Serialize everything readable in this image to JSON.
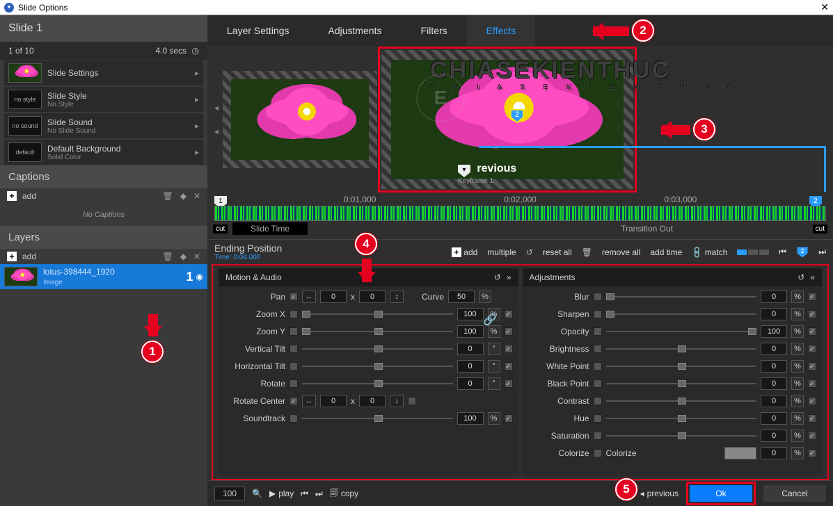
{
  "window": {
    "title": "Slide Options"
  },
  "sidebar": {
    "header": "Slide 1",
    "index": "1 of 10",
    "duration": "4.0 secs",
    "settings": {
      "slide_settings": "Slide Settings",
      "style_label": "Slide Style",
      "style_value": "No Style",
      "style_badge": "no style",
      "sound_label": "Slide Sound",
      "sound_value": "No Slide Sound",
      "sound_badge": "no sound",
      "bg_label": "Default Background",
      "bg_value": "Solid Color",
      "bg_badge": "default"
    },
    "captions_title": "Captions",
    "add_label": "add",
    "no_captions": "No Captions",
    "layers_title": "Layers",
    "layer": {
      "name": "lotus-398444_1920",
      "type": "Image",
      "index": "1"
    }
  },
  "tabs": {
    "t1": "Layer Settings",
    "t2": "Adjustments",
    "t3": "Filters",
    "t4": "Effects"
  },
  "preview": {
    "kf_prev_title": "revious",
    "kf_prev_sub": "Keyframe 1",
    "marker_num": "2"
  },
  "timeline": {
    "ticks": [
      "",
      "0:01,000",
      "0:02,000",
      "0:03,000",
      ""
    ],
    "cut": "cut",
    "slide_time": "Slide Time",
    "transition_out": "Transition Out",
    "left_marker": "1",
    "right_marker": "2"
  },
  "kf_toolbar": {
    "title": "Ending Position",
    "time": "Time: 0:04.000",
    "add": "add",
    "multiple": "multiple",
    "reset_all": "reset all",
    "remove_all": "remove all",
    "add_time": "add time",
    "match": "match",
    "cur_marker": "2"
  },
  "motion": {
    "title": "Motion & Audio",
    "pan": "Pan",
    "pan_x": "0",
    "pan_sep": "x",
    "pan_y": "0",
    "curve": "Curve",
    "curve_val": "50",
    "pct": "%",
    "zoomx": "Zoom X",
    "zoomx_val": "100",
    "zoomy": "Zoom Y",
    "zoomy_val": "100",
    "vtilt": "Vertical Tilt",
    "vtilt_val": "0",
    "deg": "°",
    "htilt": "Horizontal Tilt",
    "htilt_val": "0",
    "rotate": "Rotate",
    "rotate_val": "0",
    "rcenter": "Rotate Center",
    "rcenter_x": "0",
    "rcenter_y": "0",
    "sound": "Soundtrack",
    "sound_val": "100"
  },
  "adjust": {
    "title": "Adjustments",
    "blur": "Blur",
    "blur_val": "0",
    "sharpen": "Sharpen",
    "sharpen_val": "0",
    "opacity": "Opacity",
    "opacity_val": "100",
    "brightness": "Brightness",
    "brightness_val": "0",
    "whitepoint": "White Point",
    "whitepoint_val": "0",
    "blackpoint": "Black Point",
    "blackpoint_val": "0",
    "contrast": "Contrast",
    "contrast_val": "0",
    "hue": "Hue",
    "hue_val": "0",
    "saturation": "Saturation",
    "saturation_val": "0",
    "colorize": "Colorize",
    "colorize_lbl": "Colorize",
    "colorize_val": "0"
  },
  "footer": {
    "zoom": "100",
    "play": "play",
    "copy": "copy",
    "previous": "previous",
    "ok": "Ok",
    "cancel": "Cancel"
  },
  "callouts": {
    "c1": "1",
    "c2": "2",
    "c3": "3",
    "c4": "4",
    "c5": "5"
  }
}
